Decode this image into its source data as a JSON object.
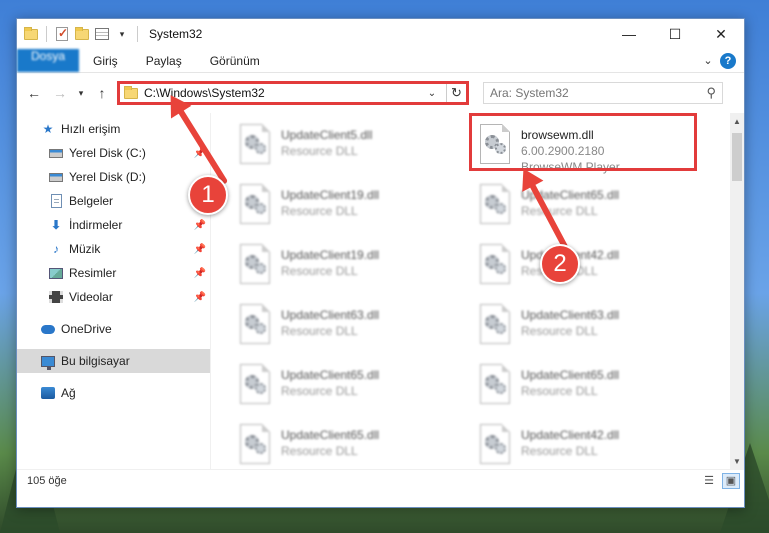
{
  "window": {
    "title": "System32"
  },
  "ribbon": {
    "tabs": [
      "Dosya",
      "Giriş",
      "Paylaş",
      "Görünüm"
    ]
  },
  "address": {
    "path": "C:\\Windows\\System32",
    "search_placeholder": "Ara: System32"
  },
  "nav": {
    "quick_access": "Hızlı erişim",
    "items": [
      {
        "label": "Yerel Disk (C:)",
        "icon": "disk-icon",
        "pinned": true
      },
      {
        "label": "Yerel Disk (D:)",
        "icon": "disk-icon",
        "pinned": false
      },
      {
        "label": "Belgeler",
        "icon": "documents-icon",
        "pinned": true
      },
      {
        "label": "İndirmeler",
        "icon": "downloads-icon",
        "pinned": true
      },
      {
        "label": "Müzik",
        "icon": "music-icon",
        "pinned": true
      },
      {
        "label": "Resimler",
        "icon": "pictures-icon",
        "pinned": true
      },
      {
        "label": "Videolar",
        "icon": "videos-icon",
        "pinned": true
      }
    ],
    "onedrive": "OneDrive",
    "this_pc": "Bu bilgisayar",
    "network": "Ağ"
  },
  "files": [
    {
      "name": "UpdateClient5.dll",
      "desc": "Resource DLL"
    },
    {
      "name": "browsewm.dll",
      "desc": "6.00.2900.2180",
      "desc2": "BrowseWM Player"
    },
    {
      "name": "UpdateClient19.dll",
      "desc": "Resource DLL"
    },
    {
      "name": "UpdateClient65.dll",
      "desc": "Resource DLL"
    },
    {
      "name": "UpdateClient19.dll",
      "desc": "Resource DLL"
    },
    {
      "name": "UpdateClient42.dll",
      "desc": "Resource DLL"
    },
    {
      "name": "UpdateClient63.dll",
      "desc": "Resource DLL"
    },
    {
      "name": "UpdateClient63.dll",
      "desc": "Resource DLL"
    },
    {
      "name": "UpdateClient65.dll",
      "desc": "Resource DLL"
    },
    {
      "name": "UpdateClient65.dll",
      "desc": "Resource DLL"
    },
    {
      "name": "UpdateClient65.dll",
      "desc": "Resource DLL"
    },
    {
      "name": "UpdateClient42.dll",
      "desc": "Resource DLL"
    }
  ],
  "status": {
    "count": "105 öğe"
  },
  "annotations": {
    "step1": "1",
    "step2": "2",
    "color": "#e8433a"
  }
}
